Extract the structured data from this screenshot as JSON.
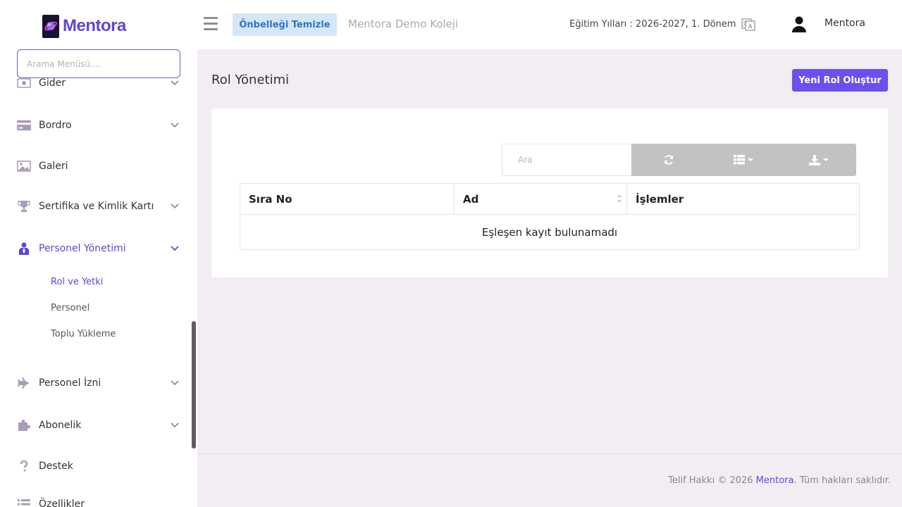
{
  "brand": {
    "name": "Mentora"
  },
  "sidebar": {
    "search_placeholder": "Arama Menüsü....",
    "items": [
      {
        "label": "Gider",
        "icon": "money-icon"
      },
      {
        "label": "Bordro",
        "icon": "credit-card-icon"
      },
      {
        "label": "Galeri",
        "icon": "image-icon"
      },
      {
        "label": "Sertifika ve Kimlik Kartı",
        "icon": "trophy-icon"
      },
      {
        "label": "Personel Yönetimi",
        "icon": "user-tie-icon"
      },
      {
        "label": "Personel İzni",
        "icon": "plane-icon"
      },
      {
        "label": "Abonelik",
        "icon": "puzzle-icon"
      },
      {
        "label": "Destek",
        "icon": "question-icon"
      },
      {
        "label": "Özellikler",
        "icon": "list-icon"
      }
    ],
    "sub_items": [
      {
        "label": "Rol ve Yetki"
      },
      {
        "label": "Personel"
      },
      {
        "label": "Toplu Yükleme"
      }
    ]
  },
  "topbar": {
    "cache_button": "Önbelleği Temizle",
    "school_name": "Mentora Demo Koleji",
    "education_years": "Eğitim Yılları : 2026-2027, 1. Dönem",
    "user_name": "Mentora"
  },
  "main": {
    "title": "Rol Yönetimi",
    "new_role_button": "Yeni Rol Oluştur",
    "table": {
      "search_placeholder": "Ara",
      "columns": [
        "Sıra No",
        "Ad",
        "İşlemler"
      ],
      "empty_message": "Eşleşen kayıt bulunamadı"
    }
  },
  "footer": {
    "prefix": "Telif Hakkı © 2026 ",
    "brand": "Mentora",
    "suffix": ". Tüm hakları saklıdır."
  },
  "colors": {
    "accent": "#6950f0",
    "brand_text": "#5a48d6",
    "cache_button_bg": "#d4e6f7",
    "toolbar_bg": "#c4c1c1",
    "page_bg": "#f1edf3"
  }
}
